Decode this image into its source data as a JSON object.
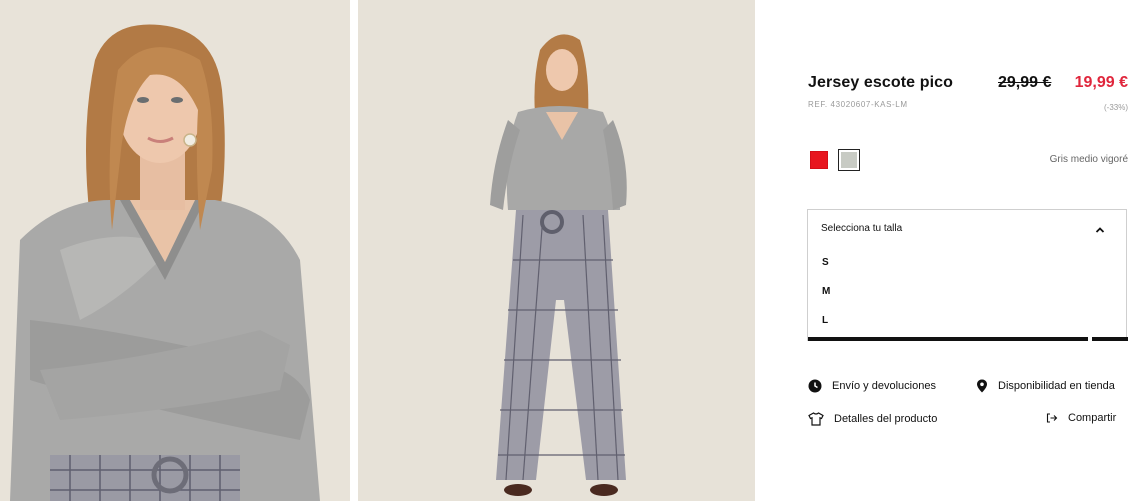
{
  "product": {
    "title": "Jersey escote pico",
    "ref": "REF. 43020607-KAS-LM",
    "price_old": "29,99 €",
    "price_new": "19,99 €",
    "discount": "(-33%)",
    "price_color": "#e0263c"
  },
  "colors": {
    "selected_name": "Gris medio vigoré",
    "swatches": [
      {
        "name": "red",
        "hex": "#e8151e"
      },
      {
        "name": "grey",
        "hex": "#c8cbc4",
        "selected": true
      }
    ]
  },
  "size_selector": {
    "header": "Selecciona tu talla",
    "expanded": true,
    "options": [
      "S",
      "M",
      "L"
    ]
  },
  "links": {
    "shipping": "Envío y devoluciones",
    "store_availability": "Disponibilidad en tienda",
    "details": "Detalles del producto",
    "share": "Compartir"
  },
  "icons": [
    "clock-icon",
    "location-pin-icon",
    "shirt-icon",
    "share-icon",
    "chevron-up-icon"
  ]
}
